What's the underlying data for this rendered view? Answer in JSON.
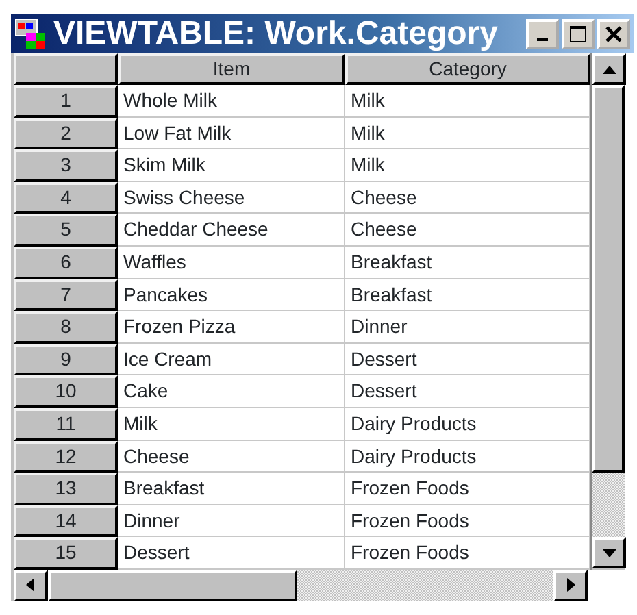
{
  "window": {
    "title": "VIEWTABLE: Work.Category"
  },
  "table": {
    "columns": [
      "Item",
      "Category"
    ],
    "rows": [
      {
        "number": "1",
        "item": "Whole Milk",
        "category": "Milk"
      },
      {
        "number": "2",
        "item": "Low Fat Milk",
        "category": "Milk"
      },
      {
        "number": "3",
        "item": "Skim Milk",
        "category": "Milk"
      },
      {
        "number": "4",
        "item": "Swiss Cheese",
        "category": "Cheese"
      },
      {
        "number": "5",
        "item": "Cheddar Cheese",
        "category": "Cheese"
      },
      {
        "number": "6",
        "item": "Waffles",
        "category": "Breakfast"
      },
      {
        "number": "7",
        "item": "Pancakes",
        "category": "Breakfast"
      },
      {
        "number": "8",
        "item": "Frozen Pizza",
        "category": "Dinner"
      },
      {
        "number": "9",
        "item": "Ice Cream",
        "category": "Dessert"
      },
      {
        "number": "10",
        "item": "Cake",
        "category": "Dessert"
      },
      {
        "number": "11",
        "item": "Milk",
        "category": "Dairy Products"
      },
      {
        "number": "12",
        "item": "Cheese",
        "category": "Dairy Products"
      },
      {
        "number": "13",
        "item": "Breakfast",
        "category": "Frozen Foods"
      },
      {
        "number": "14",
        "item": "Dinner",
        "category": "Frozen Foods"
      },
      {
        "number": "15",
        "item": "Dessert",
        "category": "Frozen Foods"
      }
    ]
  }
}
